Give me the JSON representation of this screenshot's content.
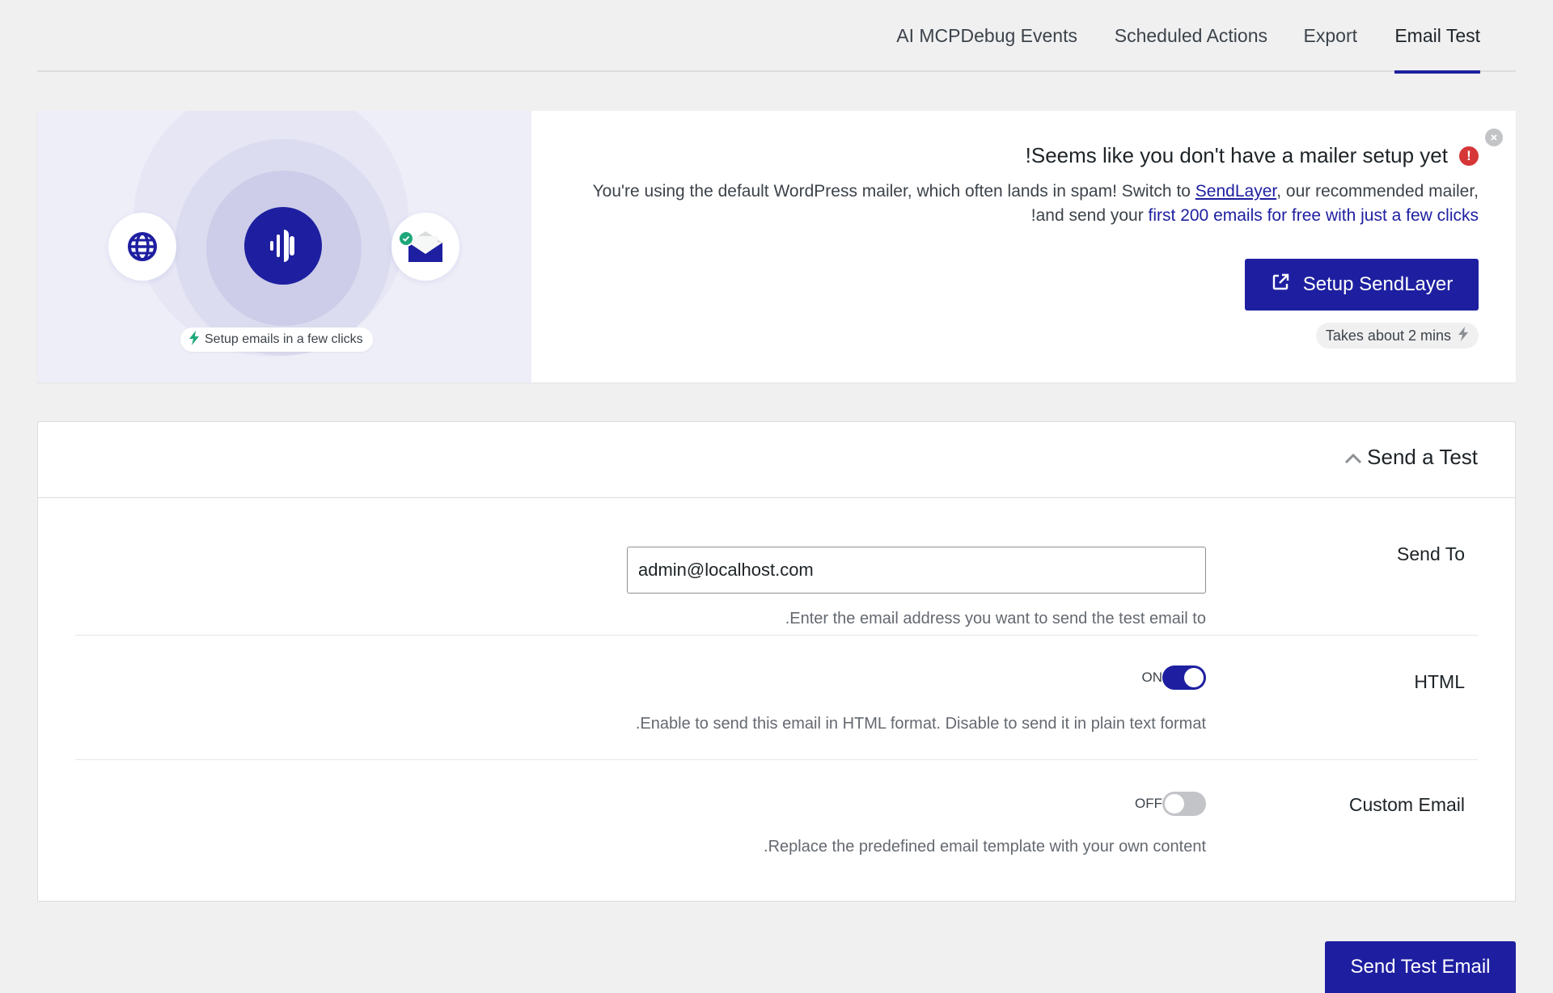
{
  "tabs": [
    {
      "label": "AI MCPDebug Events"
    },
    {
      "label": "Scheduled Actions"
    },
    {
      "label": "Export"
    },
    {
      "label": "Email Test",
      "active": true
    }
  ],
  "banner": {
    "title": "!Seems like you don't have a mailer setup yet",
    "line1_prefix": "You're using the default WordPress mailer, which often lands in spam! Switch to ",
    "line1_link": "SendLayer",
    "line1_suffix": ", our recommended mailer,",
    "line2_prefix": "!and send your ",
    "line2_highlight": "first 200 emails for free with just a few clicks",
    "setup_button": "Setup SendLayer",
    "takes_about": "Takes about 2 mins",
    "illustration_pill": "Setup emails in a few clicks",
    "warning_mark": "!"
  },
  "send_test": {
    "title": "Send a Test",
    "send_to": {
      "label": "Send To",
      "value": "admin@localhost.com",
      "description": ".Enter the email address you want to send the test email to"
    },
    "html": {
      "label": "HTML",
      "state": "ON",
      "description": ".Enable to send this email in HTML format. Disable to send it in plain text format"
    },
    "custom_email": {
      "label": "Custom Email",
      "state": "OFF",
      "description": ".Replace the predefined email template with your own content"
    },
    "send_button": "Send Test Email"
  },
  "colors": {
    "accent": "#1e1fa0",
    "warning": "#d63638",
    "success": "#1ea77a",
    "background": "#f0f0f1"
  },
  "icons": [
    "globe-icon",
    "sound-bars-icon",
    "envelope-icon",
    "check-icon",
    "bolt-icon",
    "external-link-icon",
    "close-icon",
    "warning-icon",
    "chevron-up-icon"
  ]
}
